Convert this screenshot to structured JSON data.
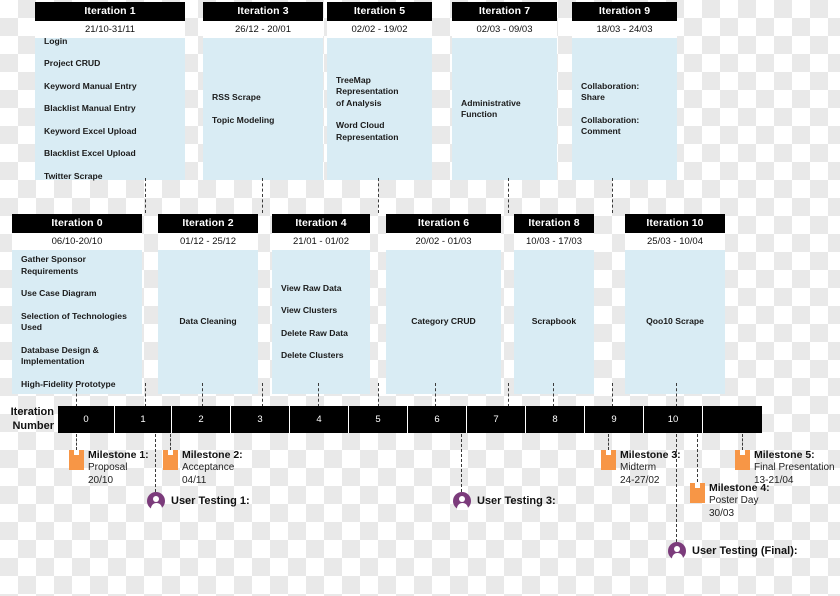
{
  "axis": {
    "label": "Iteration\nNumber",
    "label_line1": "Iteration",
    "label_line2": "Number",
    "cells": [
      "0",
      "1",
      "2",
      "3",
      "4",
      "5",
      "6",
      "7",
      "8",
      "9",
      "10",
      ""
    ]
  },
  "iterations_top": [
    {
      "title": "Iteration 1",
      "dates": "21/10-31/11",
      "align": "left",
      "tasks": [
        "Login",
        "Project CRUD",
        "Keyword Manual Entry",
        "Blacklist Manual Entry",
        "Keyword Excel Upload",
        "Blacklist Excel Upload",
        "Twitter Scrape"
      ]
    },
    {
      "title": "Iteration 3",
      "dates": "26/12 - 20/01",
      "align": "left",
      "tasks": [
        "RSS Scrape",
        "Topic Modeling"
      ]
    },
    {
      "title": "Iteration 5",
      "dates": "02/02 - 19/02",
      "align": "left",
      "tasks": [
        "TreeMap\nRepresentation\nof Analysis",
        "Word Cloud\nRepresentation"
      ]
    },
    {
      "title": "Iteration 7",
      "dates": "02/03 - 09/03",
      "align": "left",
      "tasks": [
        "Administrative\nFunction"
      ]
    },
    {
      "title": "Iteration 9",
      "dates": "18/03 - 24/03",
      "align": "left",
      "tasks": [
        "Collaboration:\nShare",
        "Collaboration:\nComment"
      ]
    }
  ],
  "iterations_bottom": [
    {
      "title": "Iteration 0",
      "dates": "06/10-20/10",
      "align": "left",
      "tasks": [
        "Gather Sponsor\nRequirements",
        "Use Case Diagram",
        "Selection of Technologies\nUsed",
        "Database Design &\nImplementation",
        "High-Fidelity Prototype"
      ]
    },
    {
      "title": "Iteration 2",
      "dates": "01/12 - 25/12",
      "align": "center",
      "tasks": [
        "Data Cleaning"
      ]
    },
    {
      "title": "Iteration 4",
      "dates": "21/01 - 01/02",
      "align": "left",
      "tasks": [
        "View Raw Data",
        "View Clusters",
        "Delete Raw Data",
        "Delete Clusters"
      ]
    },
    {
      "title": "Iteration 6",
      "dates": "20/02 - 01/03",
      "align": "center",
      "tasks": [
        "Category CRUD"
      ]
    },
    {
      "title": "Iteration 8",
      "dates": "10/03 - 17/03",
      "align": "center",
      "tasks": [
        "Scrapbook"
      ]
    },
    {
      "title": "Iteration 10",
      "dates": "25/03 - 10/04",
      "align": "center",
      "tasks": [
        "Qoo10 Scrape"
      ]
    }
  ],
  "milestones": [
    {
      "title": "Milestone 1:",
      "name": "Proposal",
      "date": "20/10"
    },
    {
      "title": "Milestone 2:",
      "name": "Acceptance",
      "date": "04/11"
    },
    {
      "title": "Milestone 3:",
      "name": "Midterm",
      "date": "24-27/02"
    },
    {
      "title": "Milestone 4:",
      "name": "Poster Day",
      "date": "30/03"
    },
    {
      "title": "Milestone 5:",
      "name": "Final Presentation",
      "date": "13-21/04"
    }
  ],
  "user_tests": [
    {
      "label": "User Testing 1:"
    },
    {
      "label": "User Testing 3:"
    },
    {
      "label": "User Testing (Final):"
    }
  ],
  "colors": {
    "header_bar": "#000000",
    "card_body": "#d9ecf4",
    "milestone_flag": "#f79646",
    "user_test_dot": "#7b3b7b",
    "dash_line": "#3a3a3a"
  }
}
